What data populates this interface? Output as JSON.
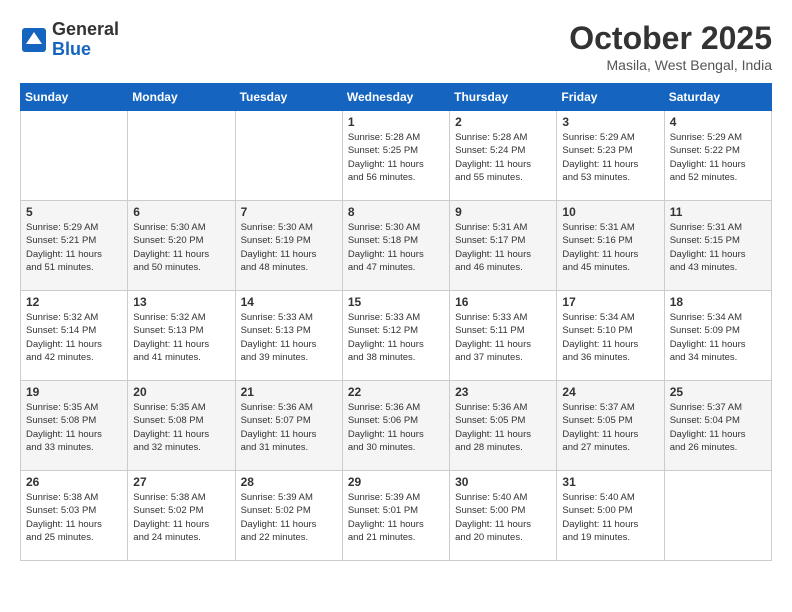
{
  "header": {
    "logo_general": "General",
    "logo_blue": "Blue",
    "title": "October 2025",
    "subtitle": "Masila, West Bengal, India"
  },
  "weekdays": [
    "Sunday",
    "Monday",
    "Tuesday",
    "Wednesday",
    "Thursday",
    "Friday",
    "Saturday"
  ],
  "weeks": [
    [
      {
        "day": "",
        "content": ""
      },
      {
        "day": "",
        "content": ""
      },
      {
        "day": "",
        "content": ""
      },
      {
        "day": "1",
        "content": "Sunrise: 5:28 AM\nSunset: 5:25 PM\nDaylight: 11 hours\nand 56 minutes."
      },
      {
        "day": "2",
        "content": "Sunrise: 5:28 AM\nSunset: 5:24 PM\nDaylight: 11 hours\nand 55 minutes."
      },
      {
        "day": "3",
        "content": "Sunrise: 5:29 AM\nSunset: 5:23 PM\nDaylight: 11 hours\nand 53 minutes."
      },
      {
        "day": "4",
        "content": "Sunrise: 5:29 AM\nSunset: 5:22 PM\nDaylight: 11 hours\nand 52 minutes."
      }
    ],
    [
      {
        "day": "5",
        "content": "Sunrise: 5:29 AM\nSunset: 5:21 PM\nDaylight: 11 hours\nand 51 minutes."
      },
      {
        "day": "6",
        "content": "Sunrise: 5:30 AM\nSunset: 5:20 PM\nDaylight: 11 hours\nand 50 minutes."
      },
      {
        "day": "7",
        "content": "Sunrise: 5:30 AM\nSunset: 5:19 PM\nDaylight: 11 hours\nand 48 minutes."
      },
      {
        "day": "8",
        "content": "Sunrise: 5:30 AM\nSunset: 5:18 PM\nDaylight: 11 hours\nand 47 minutes."
      },
      {
        "day": "9",
        "content": "Sunrise: 5:31 AM\nSunset: 5:17 PM\nDaylight: 11 hours\nand 46 minutes."
      },
      {
        "day": "10",
        "content": "Sunrise: 5:31 AM\nSunset: 5:16 PM\nDaylight: 11 hours\nand 45 minutes."
      },
      {
        "day": "11",
        "content": "Sunrise: 5:31 AM\nSunset: 5:15 PM\nDaylight: 11 hours\nand 43 minutes."
      }
    ],
    [
      {
        "day": "12",
        "content": "Sunrise: 5:32 AM\nSunset: 5:14 PM\nDaylight: 11 hours\nand 42 minutes."
      },
      {
        "day": "13",
        "content": "Sunrise: 5:32 AM\nSunset: 5:13 PM\nDaylight: 11 hours\nand 41 minutes."
      },
      {
        "day": "14",
        "content": "Sunrise: 5:33 AM\nSunset: 5:13 PM\nDaylight: 11 hours\nand 39 minutes."
      },
      {
        "day": "15",
        "content": "Sunrise: 5:33 AM\nSunset: 5:12 PM\nDaylight: 11 hours\nand 38 minutes."
      },
      {
        "day": "16",
        "content": "Sunrise: 5:33 AM\nSunset: 5:11 PM\nDaylight: 11 hours\nand 37 minutes."
      },
      {
        "day": "17",
        "content": "Sunrise: 5:34 AM\nSunset: 5:10 PM\nDaylight: 11 hours\nand 36 minutes."
      },
      {
        "day": "18",
        "content": "Sunrise: 5:34 AM\nSunset: 5:09 PM\nDaylight: 11 hours\nand 34 minutes."
      }
    ],
    [
      {
        "day": "19",
        "content": "Sunrise: 5:35 AM\nSunset: 5:08 PM\nDaylight: 11 hours\nand 33 minutes."
      },
      {
        "day": "20",
        "content": "Sunrise: 5:35 AM\nSunset: 5:08 PM\nDaylight: 11 hours\nand 32 minutes."
      },
      {
        "day": "21",
        "content": "Sunrise: 5:36 AM\nSunset: 5:07 PM\nDaylight: 11 hours\nand 31 minutes."
      },
      {
        "day": "22",
        "content": "Sunrise: 5:36 AM\nSunset: 5:06 PM\nDaylight: 11 hours\nand 30 minutes."
      },
      {
        "day": "23",
        "content": "Sunrise: 5:36 AM\nSunset: 5:05 PM\nDaylight: 11 hours\nand 28 minutes."
      },
      {
        "day": "24",
        "content": "Sunrise: 5:37 AM\nSunset: 5:05 PM\nDaylight: 11 hours\nand 27 minutes."
      },
      {
        "day": "25",
        "content": "Sunrise: 5:37 AM\nSunset: 5:04 PM\nDaylight: 11 hours\nand 26 minutes."
      }
    ],
    [
      {
        "day": "26",
        "content": "Sunrise: 5:38 AM\nSunset: 5:03 PM\nDaylight: 11 hours\nand 25 minutes."
      },
      {
        "day": "27",
        "content": "Sunrise: 5:38 AM\nSunset: 5:02 PM\nDaylight: 11 hours\nand 24 minutes."
      },
      {
        "day": "28",
        "content": "Sunrise: 5:39 AM\nSunset: 5:02 PM\nDaylight: 11 hours\nand 22 minutes."
      },
      {
        "day": "29",
        "content": "Sunrise: 5:39 AM\nSunset: 5:01 PM\nDaylight: 11 hours\nand 21 minutes."
      },
      {
        "day": "30",
        "content": "Sunrise: 5:40 AM\nSunset: 5:00 PM\nDaylight: 11 hours\nand 20 minutes."
      },
      {
        "day": "31",
        "content": "Sunrise: 5:40 AM\nSunset: 5:00 PM\nDaylight: 11 hours\nand 19 minutes."
      },
      {
        "day": "",
        "content": ""
      }
    ]
  ]
}
